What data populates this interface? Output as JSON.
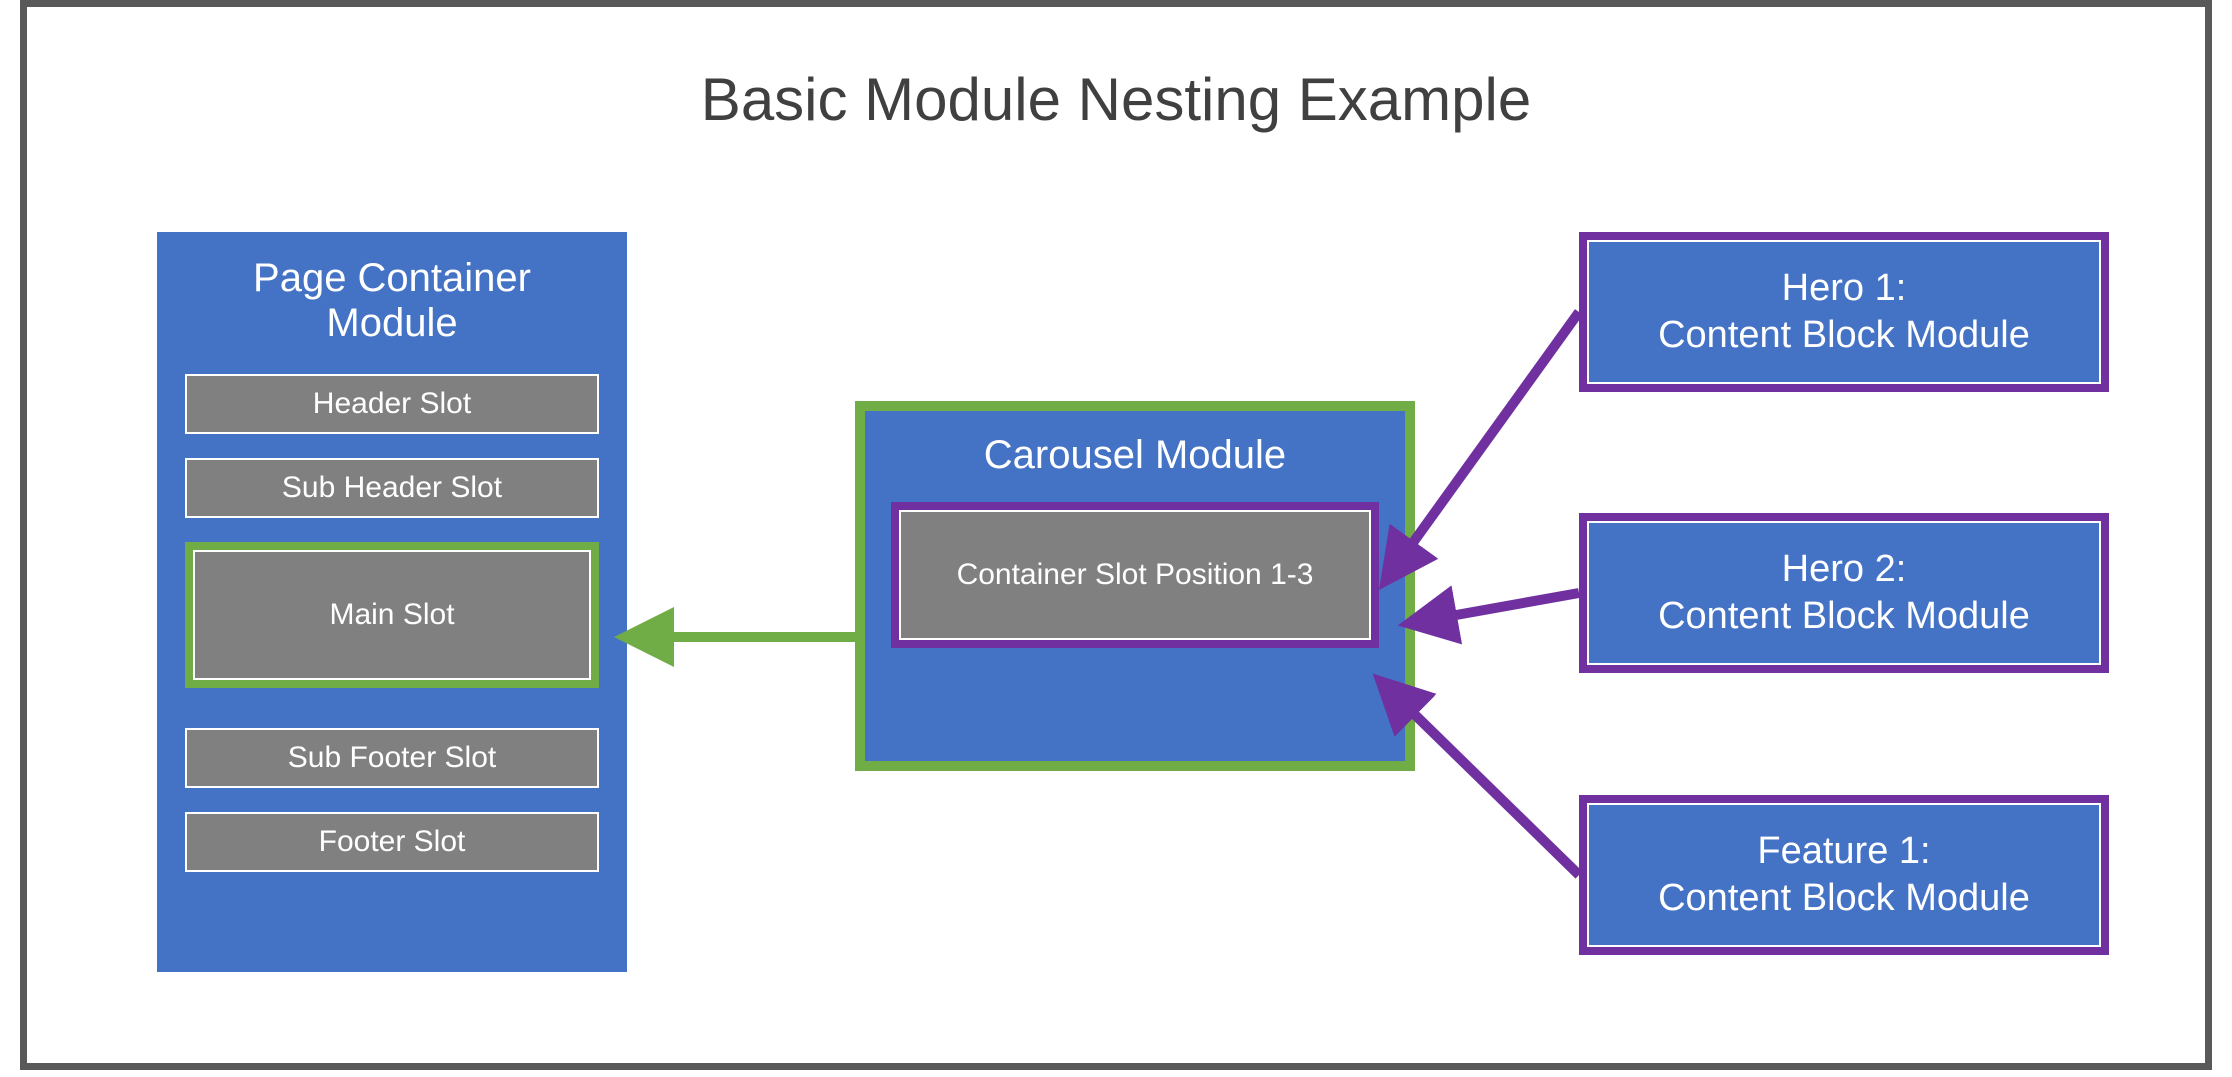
{
  "title": "Basic Module Nesting Example",
  "page_container": {
    "title": "Page Container Module",
    "slots": {
      "header": "Header Slot",
      "sub_header": "Sub Header Slot",
      "main": "Main Slot",
      "sub_footer": "Sub Footer Slot",
      "footer": "Footer Slot"
    }
  },
  "carousel": {
    "title": "Carousel Module",
    "slot_label": "Container Slot Position 1-3"
  },
  "content_blocks": {
    "hero1_line1": "Hero 1:",
    "hero1_line2": "Content Block Module",
    "hero2_line1": "Hero 2:",
    "hero2_line2": "Content Block Module",
    "feature1_line1": "Feature 1:",
    "feature1_line2": "Content Block Module"
  },
  "colors": {
    "blue": "#4472C4",
    "green": "#70AD47",
    "purple": "#7030A0",
    "gray": "#808080",
    "border": "#595959"
  }
}
